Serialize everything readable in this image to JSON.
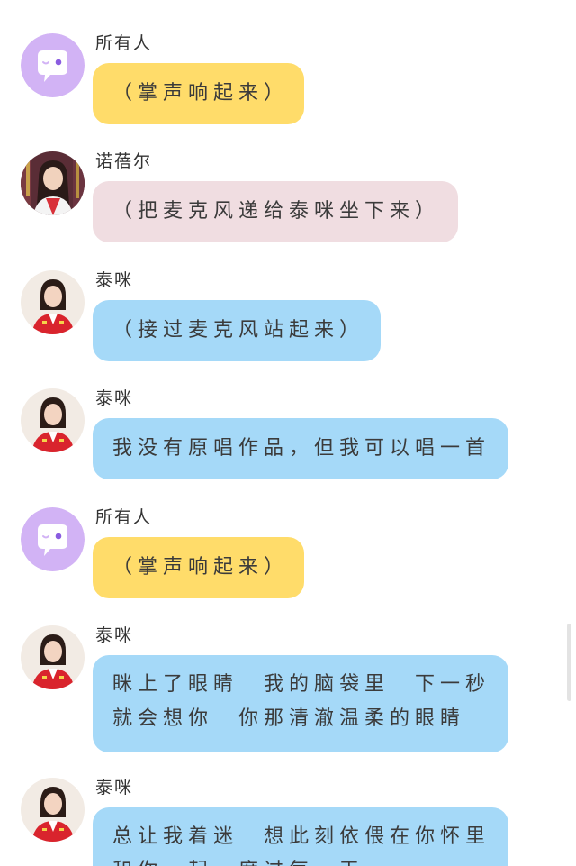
{
  "colors": {
    "group_bubble": "#ffdc6a",
    "host_bubble": "#f0dde1",
    "singer_bubble": "#a5d9f8",
    "group_avatar_bg": "#d2b3f5",
    "scrollbar": "#e3e3e3"
  },
  "icons": {
    "group_avatar": "smiley-chat-bubble-icon"
  },
  "messages": [
    {
      "sender": "所有人",
      "text": "（掌声响起来）"
    },
    {
      "sender": "诺蓓尔",
      "text": "（把麦克风递给泰咪坐下来）"
    },
    {
      "sender": "泰咪",
      "text": "（接过麦克风站起来）"
    },
    {
      "sender": "泰咪",
      "text": "我没有原唱作品，但我可以唱一首"
    },
    {
      "sender": "所有人",
      "text": "（掌声响起来）"
    },
    {
      "sender": "泰咪",
      "lines": [
        "眯上了眼睛　我的脑袋里　下一秒",
        "就会想你　你那清澈温柔的眼睛"
      ]
    },
    {
      "sender": "泰咪",
      "lines": [
        "总让我着迷　想此刻依偎在你怀里",
        "和你一起　度过每一天"
      ]
    }
  ]
}
